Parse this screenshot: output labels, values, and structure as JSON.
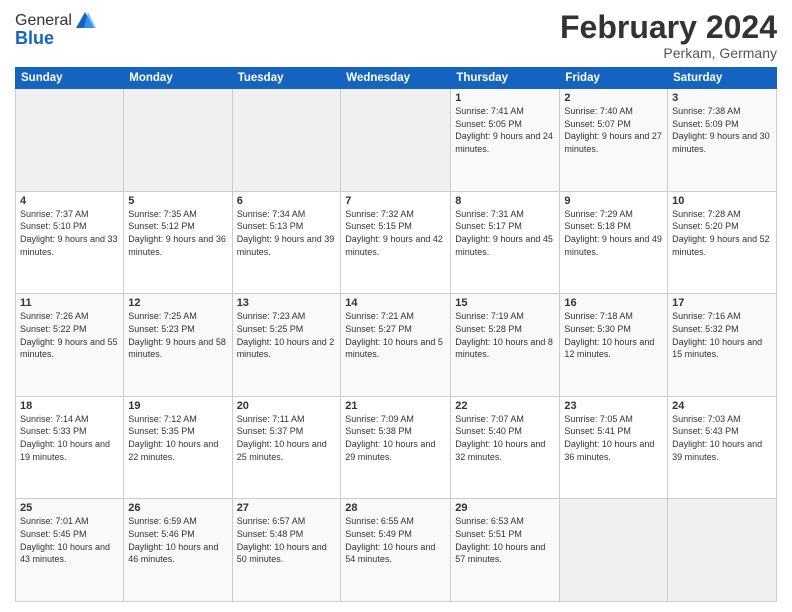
{
  "header": {
    "logo_general": "General",
    "logo_blue": "Blue",
    "title": "February 2024",
    "subtitle": "Perkam, Germany"
  },
  "weekdays": [
    "Sunday",
    "Monday",
    "Tuesday",
    "Wednesday",
    "Thursday",
    "Friday",
    "Saturday"
  ],
  "weeks": [
    [
      {
        "day": "",
        "sunrise": "",
        "sunset": "",
        "daylight": ""
      },
      {
        "day": "",
        "sunrise": "",
        "sunset": "",
        "daylight": ""
      },
      {
        "day": "",
        "sunrise": "",
        "sunset": "",
        "daylight": ""
      },
      {
        "day": "",
        "sunrise": "",
        "sunset": "",
        "daylight": ""
      },
      {
        "day": "1",
        "sunrise": "Sunrise: 7:41 AM",
        "sunset": "Sunset: 5:05 PM",
        "daylight": "Daylight: 9 hours and 24 minutes."
      },
      {
        "day": "2",
        "sunrise": "Sunrise: 7:40 AM",
        "sunset": "Sunset: 5:07 PM",
        "daylight": "Daylight: 9 hours and 27 minutes."
      },
      {
        "day": "3",
        "sunrise": "Sunrise: 7:38 AM",
        "sunset": "Sunset: 5:09 PM",
        "daylight": "Daylight: 9 hours and 30 minutes."
      }
    ],
    [
      {
        "day": "4",
        "sunrise": "Sunrise: 7:37 AM",
        "sunset": "Sunset: 5:10 PM",
        "daylight": "Daylight: 9 hours and 33 minutes."
      },
      {
        "day": "5",
        "sunrise": "Sunrise: 7:35 AM",
        "sunset": "Sunset: 5:12 PM",
        "daylight": "Daylight: 9 hours and 36 minutes."
      },
      {
        "day": "6",
        "sunrise": "Sunrise: 7:34 AM",
        "sunset": "Sunset: 5:13 PM",
        "daylight": "Daylight: 9 hours and 39 minutes."
      },
      {
        "day": "7",
        "sunrise": "Sunrise: 7:32 AM",
        "sunset": "Sunset: 5:15 PM",
        "daylight": "Daylight: 9 hours and 42 minutes."
      },
      {
        "day": "8",
        "sunrise": "Sunrise: 7:31 AM",
        "sunset": "Sunset: 5:17 PM",
        "daylight": "Daylight: 9 hours and 45 minutes."
      },
      {
        "day": "9",
        "sunrise": "Sunrise: 7:29 AM",
        "sunset": "Sunset: 5:18 PM",
        "daylight": "Daylight: 9 hours and 49 minutes."
      },
      {
        "day": "10",
        "sunrise": "Sunrise: 7:28 AM",
        "sunset": "Sunset: 5:20 PM",
        "daylight": "Daylight: 9 hours and 52 minutes."
      }
    ],
    [
      {
        "day": "11",
        "sunrise": "Sunrise: 7:26 AM",
        "sunset": "Sunset: 5:22 PM",
        "daylight": "Daylight: 9 hours and 55 minutes."
      },
      {
        "day": "12",
        "sunrise": "Sunrise: 7:25 AM",
        "sunset": "Sunset: 5:23 PM",
        "daylight": "Daylight: 9 hours and 58 minutes."
      },
      {
        "day": "13",
        "sunrise": "Sunrise: 7:23 AM",
        "sunset": "Sunset: 5:25 PM",
        "daylight": "Daylight: 10 hours and 2 minutes."
      },
      {
        "day": "14",
        "sunrise": "Sunrise: 7:21 AM",
        "sunset": "Sunset: 5:27 PM",
        "daylight": "Daylight: 10 hours and 5 minutes."
      },
      {
        "day": "15",
        "sunrise": "Sunrise: 7:19 AM",
        "sunset": "Sunset: 5:28 PM",
        "daylight": "Daylight: 10 hours and 8 minutes."
      },
      {
        "day": "16",
        "sunrise": "Sunrise: 7:18 AM",
        "sunset": "Sunset: 5:30 PM",
        "daylight": "Daylight: 10 hours and 12 minutes."
      },
      {
        "day": "17",
        "sunrise": "Sunrise: 7:16 AM",
        "sunset": "Sunset: 5:32 PM",
        "daylight": "Daylight: 10 hours and 15 minutes."
      }
    ],
    [
      {
        "day": "18",
        "sunrise": "Sunrise: 7:14 AM",
        "sunset": "Sunset: 5:33 PM",
        "daylight": "Daylight: 10 hours and 19 minutes."
      },
      {
        "day": "19",
        "sunrise": "Sunrise: 7:12 AM",
        "sunset": "Sunset: 5:35 PM",
        "daylight": "Daylight: 10 hours and 22 minutes."
      },
      {
        "day": "20",
        "sunrise": "Sunrise: 7:11 AM",
        "sunset": "Sunset: 5:37 PM",
        "daylight": "Daylight: 10 hours and 25 minutes."
      },
      {
        "day": "21",
        "sunrise": "Sunrise: 7:09 AM",
        "sunset": "Sunset: 5:38 PM",
        "daylight": "Daylight: 10 hours and 29 minutes."
      },
      {
        "day": "22",
        "sunrise": "Sunrise: 7:07 AM",
        "sunset": "Sunset: 5:40 PM",
        "daylight": "Daylight: 10 hours and 32 minutes."
      },
      {
        "day": "23",
        "sunrise": "Sunrise: 7:05 AM",
        "sunset": "Sunset: 5:41 PM",
        "daylight": "Daylight: 10 hours and 36 minutes."
      },
      {
        "day": "24",
        "sunrise": "Sunrise: 7:03 AM",
        "sunset": "Sunset: 5:43 PM",
        "daylight": "Daylight: 10 hours and 39 minutes."
      }
    ],
    [
      {
        "day": "25",
        "sunrise": "Sunrise: 7:01 AM",
        "sunset": "Sunset: 5:45 PM",
        "daylight": "Daylight: 10 hours and 43 minutes."
      },
      {
        "day": "26",
        "sunrise": "Sunrise: 6:59 AM",
        "sunset": "Sunset: 5:46 PM",
        "daylight": "Daylight: 10 hours and 46 minutes."
      },
      {
        "day": "27",
        "sunrise": "Sunrise: 6:57 AM",
        "sunset": "Sunset: 5:48 PM",
        "daylight": "Daylight: 10 hours and 50 minutes."
      },
      {
        "day": "28",
        "sunrise": "Sunrise: 6:55 AM",
        "sunset": "Sunset: 5:49 PM",
        "daylight": "Daylight: 10 hours and 54 minutes."
      },
      {
        "day": "29",
        "sunrise": "Sunrise: 6:53 AM",
        "sunset": "Sunset: 5:51 PM",
        "daylight": "Daylight: 10 hours and 57 minutes."
      },
      {
        "day": "",
        "sunrise": "",
        "sunset": "",
        "daylight": ""
      },
      {
        "day": "",
        "sunrise": "",
        "sunset": "",
        "daylight": ""
      }
    ]
  ]
}
